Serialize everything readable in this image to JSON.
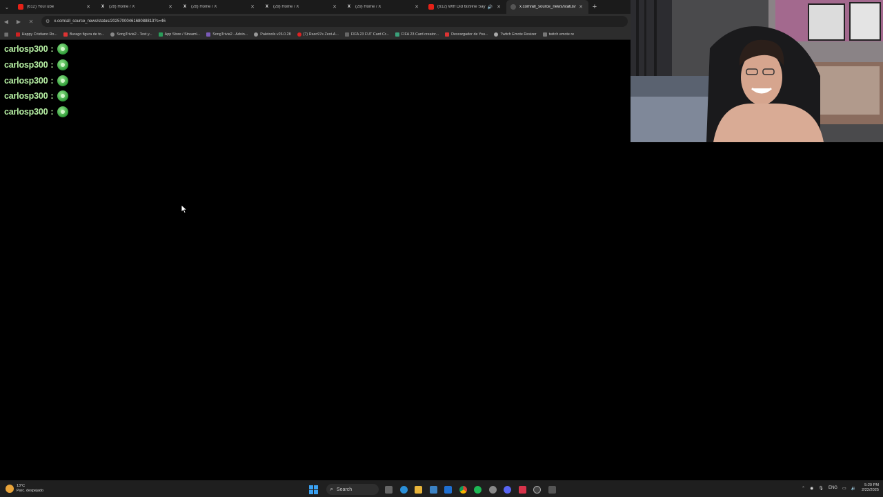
{
  "browser": {
    "tabs": [
      {
        "title": "(612) YouTube",
        "icon": "youtube-icon",
        "active": false
      },
      {
        "title": "(28) Home / X",
        "icon": "x-icon",
        "active": false
      },
      {
        "title": "(28) Home / X",
        "icon": "x-icon",
        "active": false
      },
      {
        "title": "(29) Home / X",
        "icon": "x-icon",
        "active": false
      },
      {
        "title": "(29) Home / X",
        "icon": "x-icon",
        "active": false
      },
      {
        "title": "(612) Wtff Did 6ix9ine Say",
        "icon": "youtube-icon",
        "active": false,
        "audio": true
      },
      {
        "title": "x.com/all_source_news/status/",
        "icon": "globe-icon",
        "active": true
      }
    ],
    "url": "x.com/all_source_news/status/2025700046168088813?s=46",
    "bookmarks": [
      "Happy Cristiano Ro...",
      "Burago figura de to...",
      "SongTrivia2 - Test y...",
      "App Store / Streaml...",
      "SongTrivia2 - Advin...",
      "Paletools v26.0.28",
      "(7) Razo97s Zest-A...",
      "FIFA 23 FUT Card Cr...",
      "FIFA 23 Card creator...",
      "Descargador de You...",
      "Twitch Emote Resizer",
      "twitch emote re"
    ]
  },
  "chat": {
    "lines": [
      {
        "user": "carlosp300",
        "sep": ":"
      },
      {
        "user": "carlosp300",
        "sep": ":"
      },
      {
        "user": "carlosp300",
        "sep": ":"
      },
      {
        "user": "carlosp300",
        "sep": ":"
      },
      {
        "user": "carlosp300",
        "sep": ":"
      }
    ]
  },
  "taskbar": {
    "weather_temp": "13°C",
    "weather_desc": "Parc. despejado",
    "search_label": "Search",
    "language": "ENG",
    "time": "5:20 PM",
    "date": "2/22/2025"
  },
  "colors": {
    "chat_name": "#b7f0a4",
    "emote": "#3aa83f",
    "page_bg": "#000000"
  }
}
